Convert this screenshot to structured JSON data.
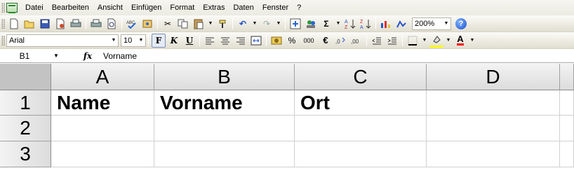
{
  "menubar": {
    "items": [
      "Datei",
      "Bearbeiten",
      "Ansicht",
      "Einfügen",
      "Format",
      "Extras",
      "Daten",
      "Fenster",
      "?"
    ]
  },
  "toolbar_standard": {
    "zoom": "200%",
    "icons": [
      "new-icon",
      "open-icon",
      "save-icon",
      "permission-icon",
      "print-icon",
      "print-preview-icon",
      "spelling-icon",
      "research-icon",
      "cut-icon",
      "copy-icon",
      "paste-icon",
      "format-painter-icon",
      "undo-icon",
      "redo-icon",
      "insert-hyperlink-icon",
      "people-icon",
      "autosum-icon",
      "sort-ascending-icon",
      "sort-descending-icon",
      "chart-wizard-icon",
      "drawing-icon",
      "help-icon"
    ],
    "autosum_glyph": "Σ"
  },
  "toolbar_formatting": {
    "font_name": "Arial",
    "font_size": "10",
    "bold_label": "F",
    "italic_label": "K",
    "underline_label": "U",
    "percent_label": "%",
    "thousands_label": "000",
    "euro_label": "€",
    "font_color_label": "A",
    "colors": {
      "fill": "#ffff00",
      "font": "#ff0000"
    }
  },
  "formula_bar": {
    "name_box": "B1",
    "fx_label": "fx",
    "content": "Vorname"
  },
  "sheet": {
    "columns": [
      "A",
      "B",
      "C",
      "D"
    ],
    "rows": [
      {
        "num": "1",
        "cells": [
          "Name",
          "Vorname",
          "Ort",
          ""
        ]
      },
      {
        "num": "2",
        "cells": [
          "",
          "",
          "",
          ""
        ]
      },
      {
        "num": "3",
        "cells": [
          "",
          "",
          "",
          ""
        ]
      }
    ]
  }
}
